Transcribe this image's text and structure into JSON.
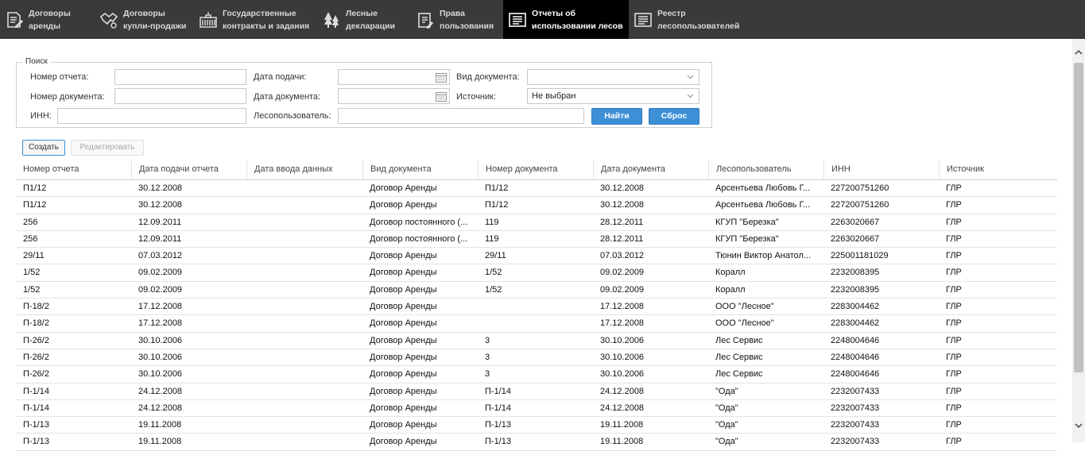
{
  "nav": [
    {
      "label": "Договоры\nаренды",
      "icon": "document-edit-icon",
      "active": false
    },
    {
      "label": "Договоры\nкупли-продажи",
      "icon": "handshake-icon",
      "active": false
    },
    {
      "label": "Государственные\nконтракты и задания",
      "icon": "government-building-icon",
      "active": false
    },
    {
      "label": "Лесные\nдекларации",
      "icon": "trees-icon",
      "active": false
    },
    {
      "label": "Права\nпользования",
      "icon": "clipboard-icon",
      "active": false
    },
    {
      "label": "Отчеты об\nиспользовании лесов",
      "icon": "report-list-icon",
      "active": true
    },
    {
      "label": "Реестр\nлесопользователей",
      "icon": "registry-list-icon",
      "active": false
    }
  ],
  "search": {
    "legend": "Поиск",
    "report_number_label": "Номер отчета:",
    "report_number_value": "",
    "document_number_label": "Номер документа:",
    "document_number_value": "",
    "inn_label": "ИНН:",
    "inn_value": "",
    "submit_date_label": "Дата подачи:",
    "submit_date_value": "",
    "document_date_label": "Дата документа:",
    "document_date_value": "",
    "forest_user_label": "Лесопользователь:",
    "forest_user_value": "",
    "doc_type_label": "Вид документа:",
    "doc_type_value": "",
    "source_label": "Источник:",
    "source_value": "Не выбран",
    "find_button": "Найти",
    "reset_button": "Сброс"
  },
  "actions": {
    "create": "Создать",
    "edit": "Редактировать"
  },
  "table": {
    "columns": [
      "Номер отчета",
      "Дата подачи отчета",
      "Дата ввода данных",
      "Вид документа",
      "Номер документа",
      "Дата документа",
      "Лесопользователь",
      "ИНН",
      "Источник"
    ],
    "rows": [
      [
        "П1/12",
        "30.12.2008",
        "",
        "Договор Аренды",
        "П1/12",
        "30.12.2008",
        "Арсентьева Любовь Г...",
        "227200751260",
        "ГЛР"
      ],
      [
        "П1/12",
        "30.12.2008",
        "",
        "Договор Аренды",
        "П1/12",
        "30.12.2008",
        "Арсентьева Любовь Г...",
        "227200751260",
        "ГЛР"
      ],
      [
        "256",
        "12.09.2011",
        "",
        "Договор постоянного (...",
        "119",
        "28.12.2011",
        "КГУП \"Березка\"",
        "2263020667",
        "ГЛР"
      ],
      [
        "256",
        "12.09.2011",
        "",
        "Договор постоянного (...",
        "119",
        "28.12.2011",
        "КГУП \"Березка\"",
        "2263020667",
        "ГЛР"
      ],
      [
        "29/11",
        "07.03.2012",
        "",
        "Договор Аренды",
        "29/11",
        "07.03.2012",
        "Тюнин Виктор Анатол...",
        "225001181029",
        "ГЛР"
      ],
      [
        "1/52",
        "09.02.2009",
        "",
        "Договор Аренды",
        "1/52",
        "09.02.2009",
        "Коралл",
        "2232008395",
        "ГЛР"
      ],
      [
        "1/52",
        "09.02.2009",
        "",
        "Договор Аренды",
        "1/52",
        "09.02.2009",
        "Коралл",
        "2232008395",
        "ГЛР"
      ],
      [
        "П-18/2",
        "17.12.2008",
        "",
        "Договор Аренды",
        "",
        "17.12.2008",
        "ООО \"Лесное\"",
        "2283004462",
        "ГЛР"
      ],
      [
        "П-18/2",
        "17.12.2008",
        "",
        "Договор Аренды",
        "",
        "17.12.2008",
        "ООО \"Лесное\"",
        "2283004462",
        "ГЛР"
      ],
      [
        "П-26/2",
        "30.10.2006",
        "",
        "Договор Аренды",
        "3",
        "30.10.2006",
        "Лес Сервис",
        "2248004646",
        "ГЛР"
      ],
      [
        "П-26/2",
        "30.10.2006",
        "",
        "Договор Аренды",
        "3",
        "30.10.2006",
        "Лес Сервис",
        "2248004646",
        "ГЛР"
      ],
      [
        "П-26/2",
        "30.10.2006",
        "",
        "Договор Аренды",
        "3",
        "30.10.2006",
        "Лес Сервис",
        "2248004646",
        "ГЛР"
      ],
      [
        "П-1/14",
        "24.12.2008",
        "",
        "Договор Аренды",
        "П-1/14",
        "24.12.2008",
        "\"Ода\"",
        "2232007433",
        "ГЛР"
      ],
      [
        "П-1/14",
        "24.12.2008",
        "",
        "Договор Аренды",
        "П-1/14",
        "24.12.2008",
        "\"Ода\"",
        "2232007433",
        "ГЛР"
      ],
      [
        "П-1/13",
        "19.11.2008",
        "",
        "Договор Аренды",
        "П-1/13",
        "19.11.2008",
        "\"Ода\"",
        "2232007433",
        "ГЛР"
      ],
      [
        "П-1/13",
        "19.11.2008",
        "",
        "Договор Аренды",
        "П-1/13",
        "19.11.2008",
        "\"Ода\"",
        "2232007433",
        "ГЛР"
      ]
    ]
  },
  "colors": {
    "nav_bg": "#3a3a3a",
    "nav_active": "#000000",
    "accent": "#3d8fd6"
  }
}
